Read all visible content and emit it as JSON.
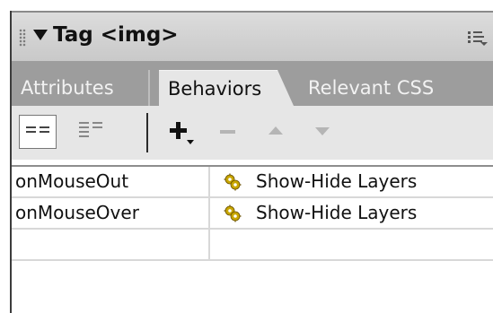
{
  "panel": {
    "title": "Tag <img>"
  },
  "tabs": [
    {
      "label": "Attributes",
      "active": false
    },
    {
      "label": "Behaviors",
      "active": true
    },
    {
      "label": "Relevant CSS",
      "active": false
    }
  ],
  "toolbar": {
    "buttons": [
      {
        "name": "show-set-events",
        "icon": "list-set-icon",
        "active": true
      },
      {
        "name": "show-all-events",
        "icon": "list-all-icon",
        "active": false
      },
      {
        "name": "add-behavior",
        "icon": "plus-icon",
        "enabled": true
      },
      {
        "name": "remove-behavior",
        "icon": "minus-icon",
        "enabled": false
      },
      {
        "name": "move-up",
        "icon": "arrow-up-icon",
        "enabled": false
      },
      {
        "name": "move-down",
        "icon": "arrow-down-icon",
        "enabled": false
      }
    ]
  },
  "behaviors": {
    "rows": [
      {
        "event": "onMouseOut",
        "action": "Show-Hide Layers",
        "icon": "behavior-gear-icon"
      },
      {
        "event": "onMouseOver",
        "action": "Show-Hide Layers",
        "icon": "behavior-gear-icon"
      },
      {
        "event": "",
        "action": "",
        "icon": ""
      }
    ]
  },
  "colors": {
    "titlebar": "#d3d3d3",
    "tabstrip": "#9d9d9d",
    "active_tab": "#e6e6e6",
    "gear": "#c8a600"
  }
}
